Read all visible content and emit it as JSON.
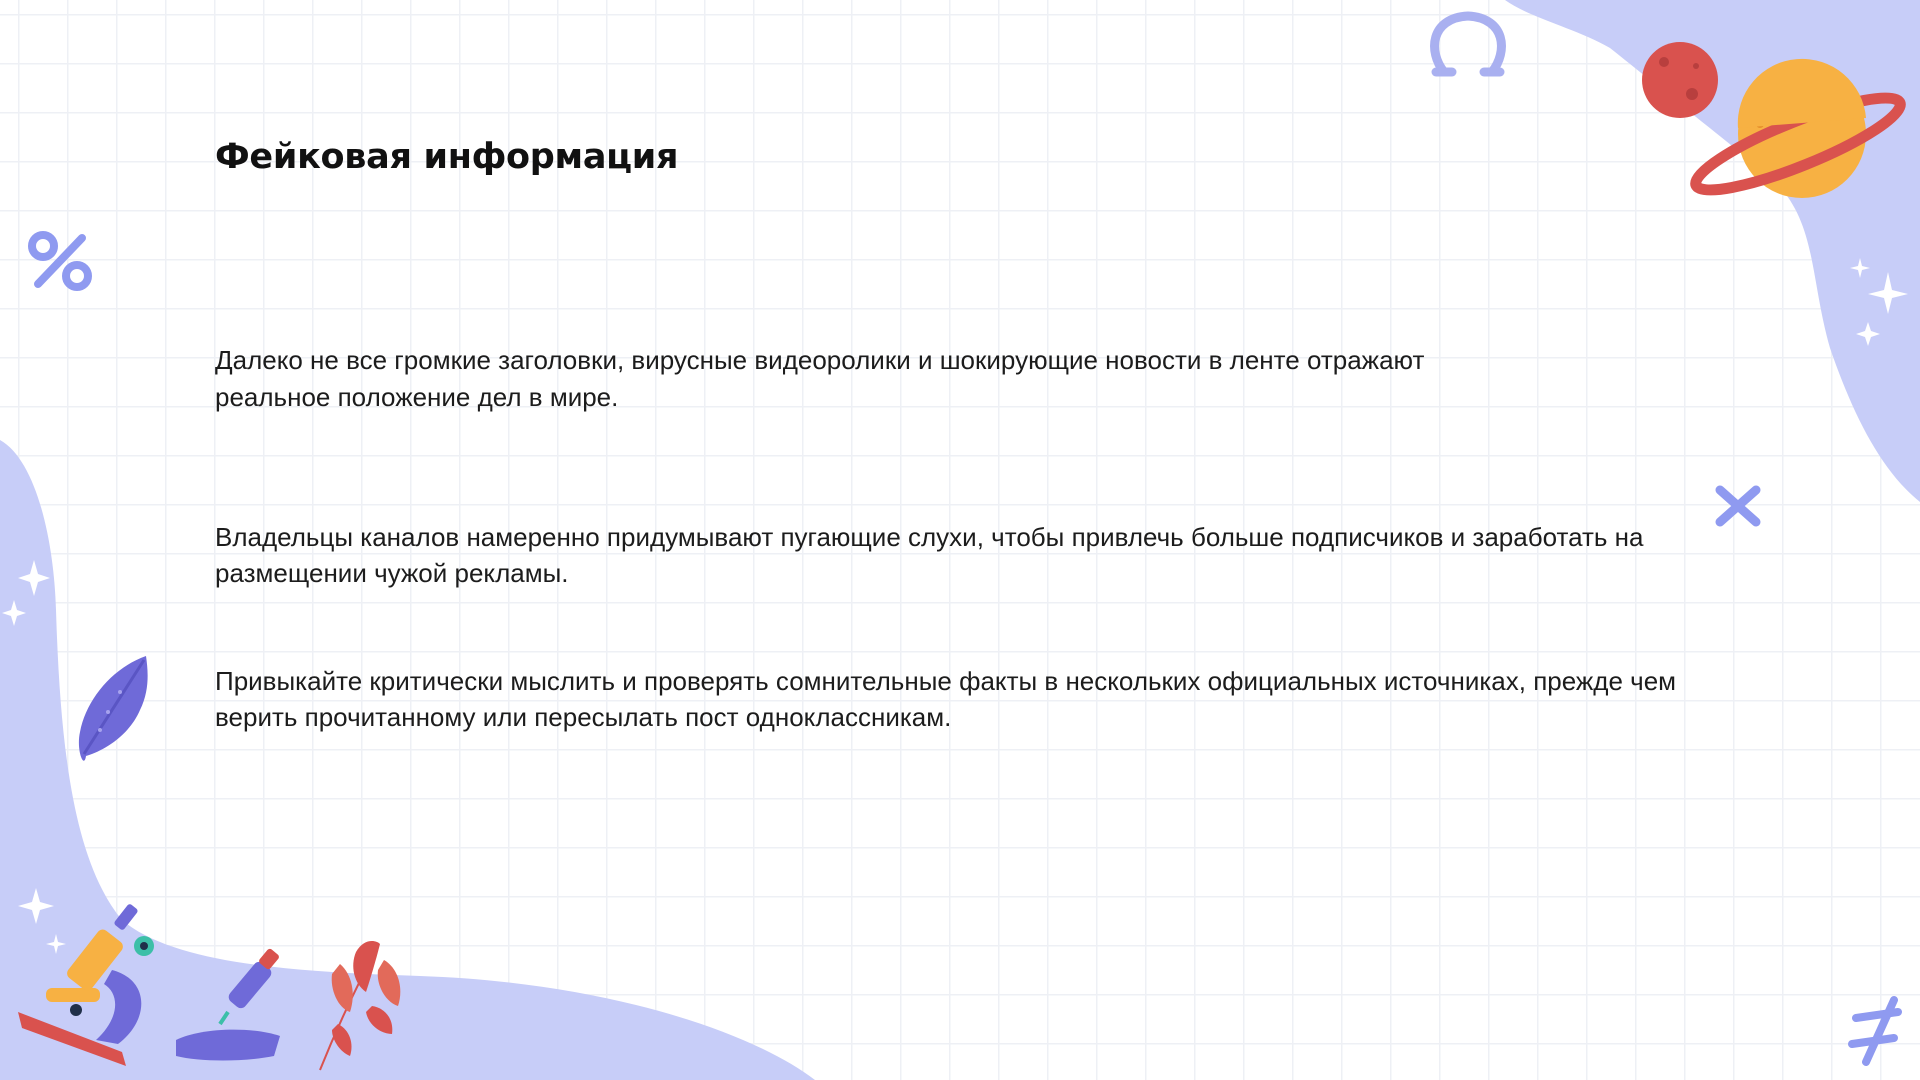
{
  "slide": {
    "title": "Фейковая информация",
    "paragraphs": [
      "Далеко не все громкие заголовки, вирусные видеоролики и шокирующие новости в ленте отражают реальное положение дел в мире.",
      "Владельцы каналов намеренно придумывают пугающие слухи, чтобы привлечь больше подписчиков и заработать на размещении чужой рекламы.",
      "Привыкайте критически мыслить и проверять сомнительные факты в нескольких официальных источниках, прежде чем верить прочитанному или пересылать пост одноклассникам."
    ]
  },
  "decorations": {
    "icons": [
      "omega-icon",
      "percent-icon",
      "times-icon",
      "not-equal-icon",
      "sparkle-icon",
      "planet-red-icon",
      "saturn-icon",
      "leaf-icon",
      "microscope-icon",
      "pipette-icon",
      "plant-icon"
    ]
  },
  "colors": {
    "blob": "#c7cdf8",
    "symbol": "#8f9af0",
    "accent_purple": "#6f6ad8",
    "planet_red": "#d9524e",
    "saturn_orange": "#f7b143",
    "text": "#1c1c1c"
  }
}
